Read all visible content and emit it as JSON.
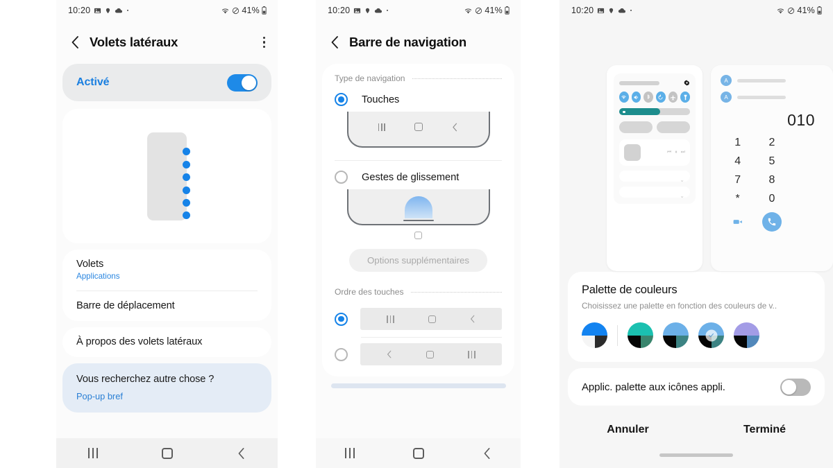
{
  "statusbar": {
    "time": "10:20",
    "battery": "41%",
    "icons_left": [
      "image-icon",
      "location-icon",
      "cloud-icon",
      "dot-icon"
    ],
    "icons_right": [
      "wifi-icon",
      "mute-icon",
      "battery-icon"
    ]
  },
  "panel1": {
    "title": "Volets latéraux",
    "back_icon": "back-chevron-icon",
    "menu_icon": "kebab-menu-icon",
    "master_toggle": {
      "label": "Activé",
      "state": "on"
    },
    "items": [
      {
        "title": "Volets",
        "subtitle": "Applications"
      },
      {
        "title": "Barre de déplacement",
        "subtitle": ""
      },
      {
        "title": "À propos des volets latéraux",
        "subtitle": ""
      }
    ],
    "hint": {
      "question": "Vous recherchez autre chose ?",
      "link": "Pop-up bref"
    },
    "navbar": [
      "recents-icon",
      "home-icon",
      "back-icon"
    ]
  },
  "panel2": {
    "title": "Barre de navigation",
    "back_icon": "back-chevron-icon",
    "section_nav_type": "Type de navigation",
    "options": [
      {
        "label": "Touches",
        "selected": true
      },
      {
        "label": "Gestes de glissement",
        "selected": false
      }
    ],
    "more_options_button": "Options supplémentaires",
    "section_button_order": "Ordre des touches",
    "orders": [
      {
        "keys": [
          "recents-icon",
          "home-icon",
          "back-icon"
        ],
        "selected": true
      },
      {
        "keys": [
          "back-icon",
          "home-icon",
          "recents-icon"
        ],
        "selected": false
      }
    ],
    "navbar": [
      "recents-icon",
      "home-icon",
      "back-icon"
    ]
  },
  "panel3": {
    "quick_panel_preview": {
      "toggles": [
        "wifi-icon",
        "sound-icon",
        "bluetooth-icon",
        "rotate-icon",
        "airplane-icon",
        "flashlight-icon"
      ],
      "toggle_states": [
        "on",
        "on",
        "off",
        "on",
        "off",
        "on"
      ],
      "settings_icon": "gear-icon",
      "media_controls": [
        "previous-icon",
        "pause-icon",
        "next-icon"
      ]
    },
    "dialer_preview": {
      "number": "010",
      "keys": [
        "1",
        "2",
        "4",
        "5",
        "7",
        "8",
        "*",
        "0"
      ],
      "avatar_letter": "A",
      "video_icon": "video-call-icon",
      "call_icon": "call-icon"
    },
    "palette": {
      "title": "Palette de couleurs",
      "subtitle": "Choisissez une palette en fonction des couleurs de v..",
      "selected_index": 3,
      "check_icon": "check-icon",
      "swatches": [
        {
          "name": "blue-white",
          "top": "#1383f0",
          "bl": "#f5f5f5",
          "br": "#2b2b2b"
        },
        {
          "name": "teal-green",
          "top": "#1bc0b0",
          "bl": "#050505",
          "br": "#39856d"
        },
        {
          "name": "sky-teal",
          "top": "#6cb0e8",
          "bl": "#050505",
          "br": "#3c8383"
        },
        {
          "name": "sky-teal-selected",
          "top": "#6cb0e8",
          "bl": "#050505",
          "br": "#3c8383"
        },
        {
          "name": "lavender-blue",
          "top": "#a39ce6",
          "bl": "#050505",
          "br": "#5288bb"
        }
      ]
    },
    "apply_row": {
      "label": "Applic. palette aux icônes appli.",
      "state": "off"
    },
    "buttons": {
      "cancel": "Annuler",
      "done": "Terminé"
    }
  },
  "colors": {
    "accent_blue": "#1683e8",
    "link_blue": "#2a86e0",
    "teal": "#1d8d8d"
  }
}
